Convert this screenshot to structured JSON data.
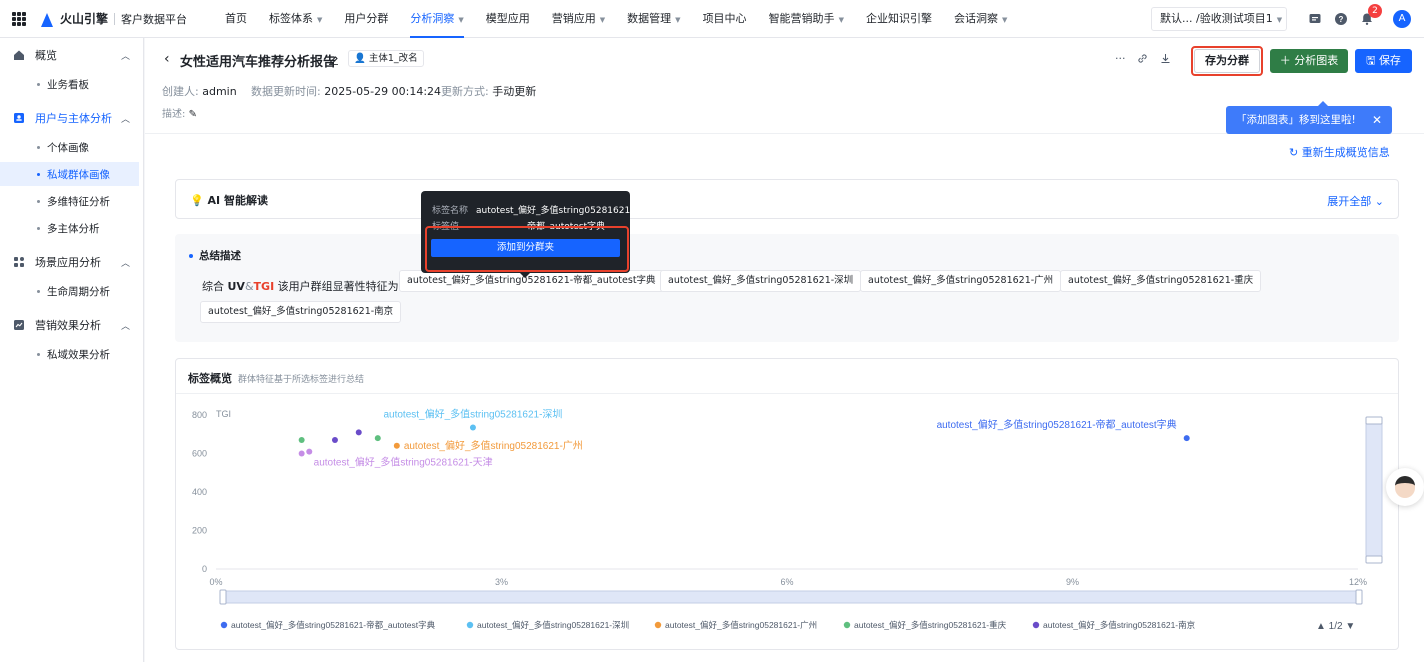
{
  "topbar": {
    "brand": "火山引擎",
    "platform": "客户数据平台",
    "nav": [
      {
        "label": "首页",
        "has_caret": false,
        "active": false
      },
      {
        "label": "标签体系",
        "has_caret": true,
        "active": false
      },
      {
        "label": "用户分群",
        "has_caret": false,
        "active": false
      },
      {
        "label": "分析洞察",
        "has_caret": true,
        "active": true
      },
      {
        "label": "模型应用",
        "has_caret": false,
        "active": false
      },
      {
        "label": "营销应用",
        "has_caret": true,
        "active": false
      },
      {
        "label": "数据管理",
        "has_caret": true,
        "active": false
      },
      {
        "label": "项目中心",
        "has_caret": false,
        "active": false
      },
      {
        "label": "智能营销助手",
        "has_caret": true,
        "active": false
      },
      {
        "label": "企业知识引擎",
        "has_caret": false,
        "active": false
      },
      {
        "label": "会话洞察",
        "has_caret": true,
        "active": false
      }
    ],
    "project": "默认... /验收测试项目1",
    "notification_count": "2",
    "avatar_letter": "A"
  },
  "sidebar": {
    "groups": [
      {
        "label": "概览",
        "icon": "home-icon",
        "active": false,
        "items": [
          {
            "label": "业务看板",
            "active": false
          }
        ]
      },
      {
        "label": "用户与主体分析",
        "icon": "user-card-icon",
        "active": true,
        "items": [
          {
            "label": "个体画像",
            "active": false
          },
          {
            "label": "私域群体画像",
            "active": true
          },
          {
            "label": "多维特征分析",
            "active": false
          },
          {
            "label": "多主体分析",
            "active": false
          }
        ]
      },
      {
        "label": "场景应用分析",
        "icon": "apps-icon",
        "active": false,
        "items": [
          {
            "label": "生命周期分析",
            "active": false
          }
        ]
      },
      {
        "label": "营销效果分析",
        "icon": "trend-icon",
        "active": false,
        "items": [
          {
            "label": "私域效果分析",
            "active": false
          }
        ]
      }
    ]
  },
  "header": {
    "title": "女性适用汽车推荐分析报告",
    "subject_tag": "主体1_改名",
    "creator_label": "创建人:",
    "creator": "admin",
    "updated_label": "数据更新时间:",
    "updated": "2025-05-29 00:14:24",
    "mode_label": "更新方式:",
    "mode": "手动更新",
    "desc_label": "描述:",
    "save_segment": "存为分群",
    "analysis_chart": "分析图表",
    "save": "保存",
    "tip": "「添加图表」移到这里啦!"
  },
  "content": {
    "regen": "重新生成概览信息",
    "ai_title": "AI 智能解读",
    "expand_all": "展开全部",
    "summary_title": "总结描述",
    "summary_lead": {
      "pre": "综合",
      "uv": "UV",
      "amp": "&",
      "tgi": "TGI",
      "post": "该用户群组显著性特征为:"
    },
    "chips": [
      "autotest_偏好_多值string05281621-帝都_autotest字典",
      "autotest_偏好_多值string05281621-深圳",
      "autotest_偏好_多值string05281621-广州",
      "autotest_偏好_多值string05281621-重庆",
      "autotest_偏好_多值string05281621-南京"
    ],
    "tag_title": "标签概览",
    "tag_sub": "群体特征基于所选标签进行总结"
  },
  "popover": {
    "name_key": "标签名称",
    "name_val": "autotest_偏好_多值string05281621",
    "value_key": "标签值",
    "value_val": "帝都_autotest字典",
    "button": "添加到分群夹"
  },
  "chart_data": {
    "type": "scatter",
    "ylabel": "TGI",
    "xlim": [
      0,
      12
    ],
    "ylim": [
      0,
      800
    ],
    "x_ticks": [
      "0%",
      "3%",
      "6%",
      "9%",
      "12%"
    ],
    "y_ticks": [
      "0",
      "200",
      "400",
      "600",
      "800"
    ],
    "legend_page": "1/2",
    "series": [
      {
        "name": "autotest_偏好_多值string05281621-帝都_autotest字典",
        "color": "#3e6cf0",
        "points": [
          [
            10.2,
            680
          ]
        ],
        "label": "autotest_偏好_多值string05281621-帝都_autotest字典"
      },
      {
        "name": "autotest_偏好_多值string05281621-深圳",
        "color": "#5cc0f2",
        "points": [
          [
            2.7,
            735
          ]
        ],
        "label": "autotest_偏好_多值string05281621-深圳"
      },
      {
        "name": "autotest_偏好_多值string05281621-广州",
        "color": "#f29a3b",
        "points": [
          [
            1.9,
            640
          ]
        ],
        "label": "autotest_偏好_多值string05281621-广州"
      },
      {
        "name": "autotest_偏好_多值string05281621-重庆",
        "color": "#5fbf7f",
        "points": [
          [
            0.9,
            670
          ],
          [
            1.7,
            680
          ]
        ],
        "label": ""
      },
      {
        "name": "autotest_偏好_多值string05281621-南京",
        "color": "#6a4cc9",
        "points": [
          [
            1.25,
            670
          ],
          [
            1.5,
            710
          ]
        ],
        "label": ""
      },
      {
        "name": "autotest_偏好_多值string05281621-天津",
        "color": "#c58de6",
        "points": [
          [
            0.9,
            600
          ],
          [
            0.98,
            610
          ]
        ],
        "label": "autotest_偏好_多值string05281621-天津"
      }
    ]
  }
}
